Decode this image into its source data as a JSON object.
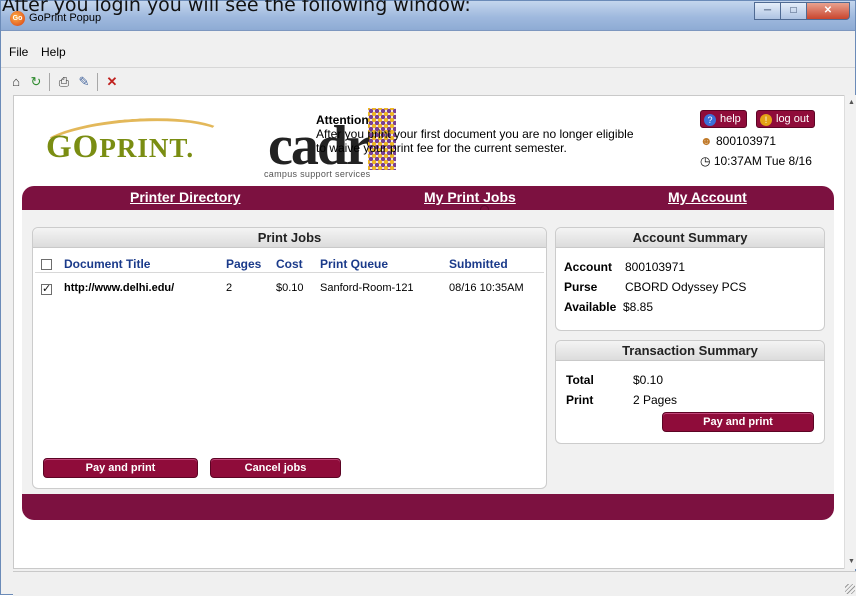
{
  "caption": "After you login you will see the following window:",
  "window": {
    "title": "GoPrint Popup",
    "app_icon": "Go",
    "minimize_icon": "minimize-icon",
    "maximize_icon": "maximize-icon",
    "close_icon": "close-icon"
  },
  "menu": {
    "file": "File",
    "help": "Help"
  },
  "toolbar_icons": [
    "home-icon",
    "refresh-icon",
    "print-icon",
    "edit-icon",
    "stop-icon"
  ],
  "logo": {
    "go": "GO",
    "print": "PRINT",
    "mark": "."
  },
  "cadr": {
    "word": "cadr",
    "subtitle": "campus support services"
  },
  "attention": {
    "title": "Attention",
    "text": "After you print your first document you are no longer eligible to waive your print fee for the current semester."
  },
  "header_buttons": {
    "help": "help",
    "logout": "log out"
  },
  "user": {
    "id": "800103971",
    "time": "10:37AM Tue 8/16"
  },
  "nav": {
    "printer_directory": "Printer Directory",
    "my_print_jobs": "My Print Jobs",
    "my_account": "My Account"
  },
  "print_jobs": {
    "title": "Print Jobs",
    "columns": [
      "Document Title",
      "Pages",
      "Cost",
      "Print Queue",
      "Submitted"
    ],
    "rows": [
      {
        "checked": true,
        "title": "http://www.delhi.edu/",
        "pages": "2",
        "cost": "$0.10",
        "queue": "Sanford-Room-121",
        "submitted": "08/16 10:35AM"
      }
    ],
    "pay_button": "Pay and print",
    "cancel_button": "Cancel jobs"
  },
  "account_summary": {
    "title": "Account Summary",
    "account_label": "Account",
    "account_value": "800103971",
    "purse_label": "Purse",
    "purse_value": "CBORD Odyssey PCS",
    "available_label": "Available",
    "available_value": "$8.85"
  },
  "transaction_summary": {
    "title": "Transaction Summary",
    "total_label": "Total",
    "total_value": "$0.10",
    "print_label": "Print",
    "print_value": "2 Pages",
    "pay_button": "Pay and print"
  },
  "colors": {
    "brand": "#7c1140",
    "header_link": "#1a3a8a",
    "logo_green": "#7a8d12"
  }
}
